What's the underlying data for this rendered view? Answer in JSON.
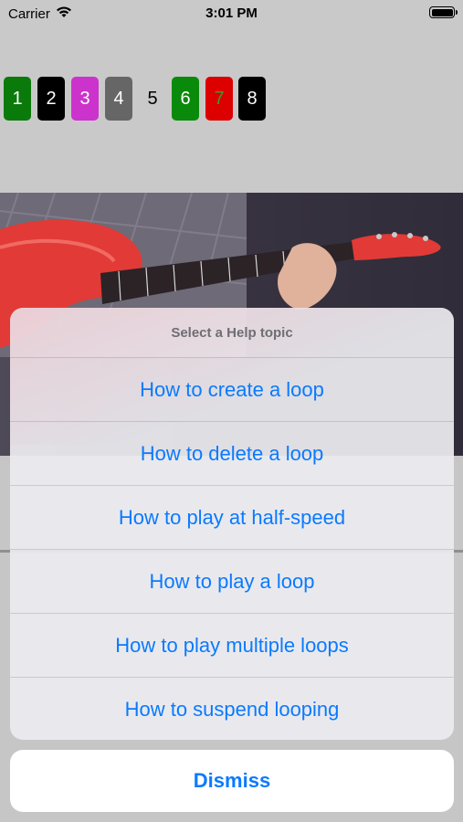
{
  "status_bar": {
    "carrier": "Carrier",
    "time": "3:01 PM"
  },
  "loop_buttons": [
    {
      "label": "1",
      "bg": "#0a7a0a",
      "fg": "#ffffff"
    },
    {
      "label": "2",
      "bg": "#000000",
      "fg": "#ffffff"
    },
    {
      "label": "3",
      "bg": "#cc33cc",
      "fg": "#ffffff"
    },
    {
      "label": "4",
      "bg": "#666666",
      "fg": "#ffffff"
    },
    {
      "label": "5",
      "bg": "transparent",
      "fg": "#000000"
    },
    {
      "label": "6",
      "bg": "#0a8a0a",
      "fg": "#ffffff"
    },
    {
      "label": "7",
      "bg": "#dd0000",
      "fg": "#2e9e2e"
    },
    {
      "label": "8",
      "bg": "#000000",
      "fg": "#ffffff"
    }
  ],
  "action_sheet": {
    "title": "Select a Help topic",
    "options": [
      "How to create a loop",
      "How to delete a loop",
      "How to play at half-speed",
      "How to play a loop",
      "How to play multiple loops",
      "How to suspend looping"
    ],
    "dismiss": "Dismiss"
  },
  "colors": {
    "accent": "#0a7aff",
    "sheet_title": "#6e6e73"
  },
  "icons": {
    "wifi": "wifi-icon",
    "battery": "battery-icon"
  }
}
